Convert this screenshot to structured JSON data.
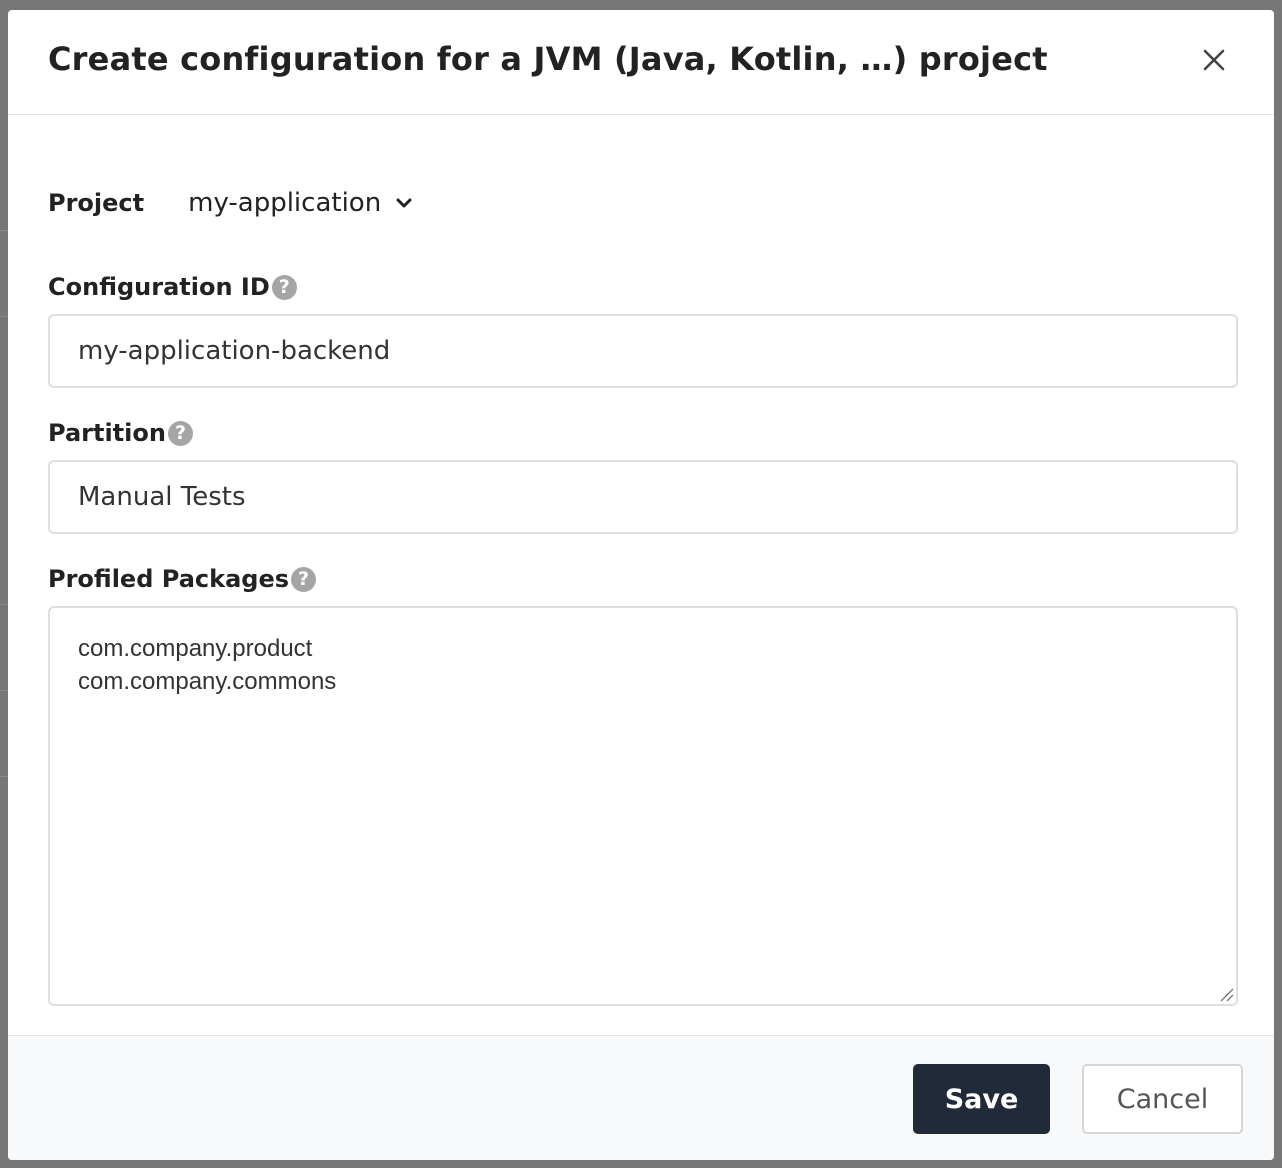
{
  "dialog": {
    "title": "Create configuration for a JVM (Java, Kotlin, …) project"
  },
  "project": {
    "label": "Project",
    "selected": "my-application"
  },
  "configuration_id": {
    "label": "Configuration ID",
    "value": "my-application-backend"
  },
  "partition": {
    "label": "Partition",
    "value": "Manual Tests"
  },
  "profiled_packages": {
    "label": "Profiled Packages",
    "value": "com.company.product\ncom.company.commons"
  },
  "footer": {
    "save_label": "Save",
    "cancel_label": "Cancel"
  },
  "icons": {
    "close": "close-icon",
    "dropdown": "chevron-down-icon",
    "help": "question-circle-icon"
  },
  "colors": {
    "primary_button": "#212a38",
    "help_icon": "#a5a5a5",
    "overlay": "#777777"
  }
}
